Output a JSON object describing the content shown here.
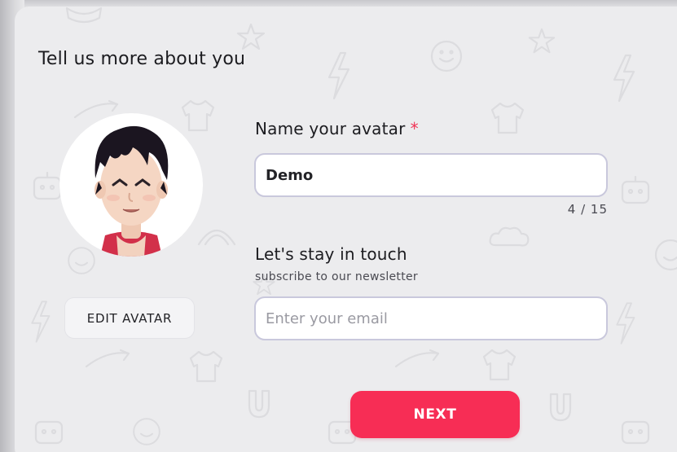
{
  "form": {
    "title": "Tell us more about you",
    "name_label": "Name your avatar",
    "required_marker": "*",
    "name_value": "Demo",
    "char_counter": "4 / 15",
    "touch_label": "Let's stay in touch",
    "touch_subtitle": "subscribe to our newsletter",
    "email_placeholder": "Enter your email"
  },
  "buttons": {
    "edit_avatar": "EDIT AVATAR",
    "next": "NEXT"
  },
  "colors": {
    "accent": "#f72d55",
    "background": "#ececee",
    "input_border": "#c9c8dc"
  },
  "icons": [
    "avatar-portrait",
    "doodle-background-pattern"
  ]
}
